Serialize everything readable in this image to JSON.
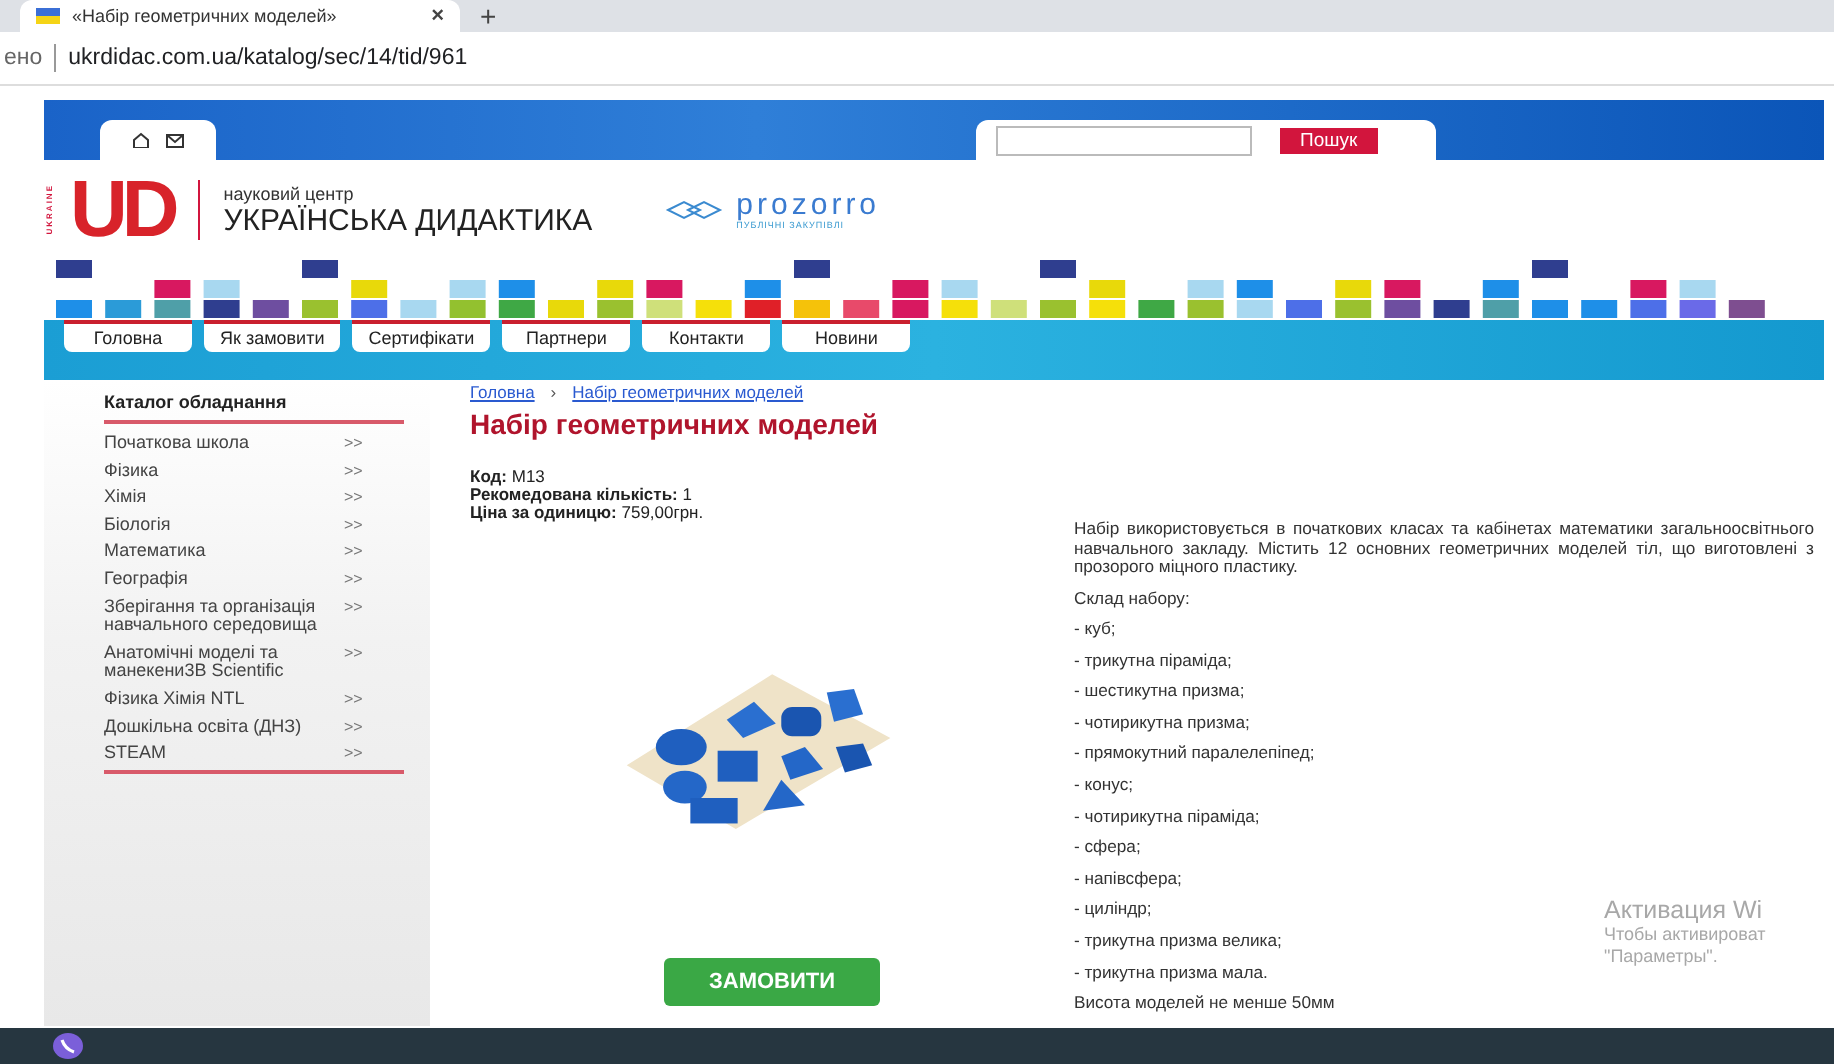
{
  "browser": {
    "tab_title": "«Набір геометричних моделей»",
    "new_tab": "+",
    "close": "×",
    "address_prefix": "ено",
    "url": "ukrdidac.com.ua/katalog/sec/14/tid/961"
  },
  "header": {
    "search_button": "Пошук",
    "logo_side": "UKRAINE",
    "logo": "UD",
    "logo_small": "науковий центр",
    "logo_name": "УКРАЇНСЬКА ДИДАКТИКА",
    "partner": "prozorro",
    "partner_sub": "ПУБЛІЧНІ ЗАКУПІВЛІ"
  },
  "nav": [
    "Головна",
    "Як замовити",
    "Сертифікати",
    "Партнери",
    "Контакти",
    "Новини"
  ],
  "sidebar": {
    "title": "Каталог обладнання",
    "items": [
      {
        "label": "Початкова школа",
        "arrow": ">>"
      },
      {
        "label": "Фізика",
        "arrow": ">>"
      },
      {
        "label": "Хімія",
        "arrow": ">>"
      },
      {
        "label": "Біологія",
        "arrow": ">>"
      },
      {
        "label": "Математика",
        "arrow": ">>"
      },
      {
        "label": "Географія",
        "arrow": ">>"
      },
      {
        "label": "Зберігання та організація навчального середовища",
        "arrow": ">>"
      },
      {
        "label": "Анатомічні моделі та манекени3B Scientific",
        "arrow": ">>"
      },
      {
        "label": "Фізика Хімія NTL",
        "arrow": ">>"
      },
      {
        "label": "Дошкільна освіта (ДНЗ)",
        "arrow": ">>"
      },
      {
        "label": "STEAM",
        "arrow": ">>"
      }
    ]
  },
  "breadcrumb": [
    {
      "label": "Головна"
    },
    {
      "label": "Набір геометричних моделей"
    }
  ],
  "breadcrumb_separator": "›",
  "product": {
    "title": "Набір геометричних моделей",
    "specs": [
      {
        "label": "Код:",
        "value": "M13"
      },
      {
        "label": "Рекомедована кількість:",
        "value": "1"
      },
      {
        "label": "Ціна за одиницю:",
        "value": "759,00грн."
      }
    ],
    "order_button": "ЗАМОВИТИ",
    "description": "Набір використовується в початкових класах та кабінетах математики загальноосвітнього навчального закладу. Містить 12 основних геометричних моделей тіл, що виготовлені з прозорого міцного пластику.",
    "list_title": "Склад набору:",
    "list": [
      "- куб;",
      "- трикутна піраміда;",
      "- шестикутна призма;",
      "- чотирикутна призма;",
      "- прямокутний паралелепіпед;",
      "- конус;",
      "- чотирикутна піраміда;",
      "- сфера;",
      "- напівсфера;",
      "- циліндр;",
      "- трикутна призма велика;",
      "- трикутна призма мала."
    ],
    "footer_line": "Висота моделей не менше 50мм"
  },
  "os_notice": {
    "title": "Активация Wi",
    "line_1": "Чтобы активироват",
    "line_2": "\"Параметры\"."
  }
}
